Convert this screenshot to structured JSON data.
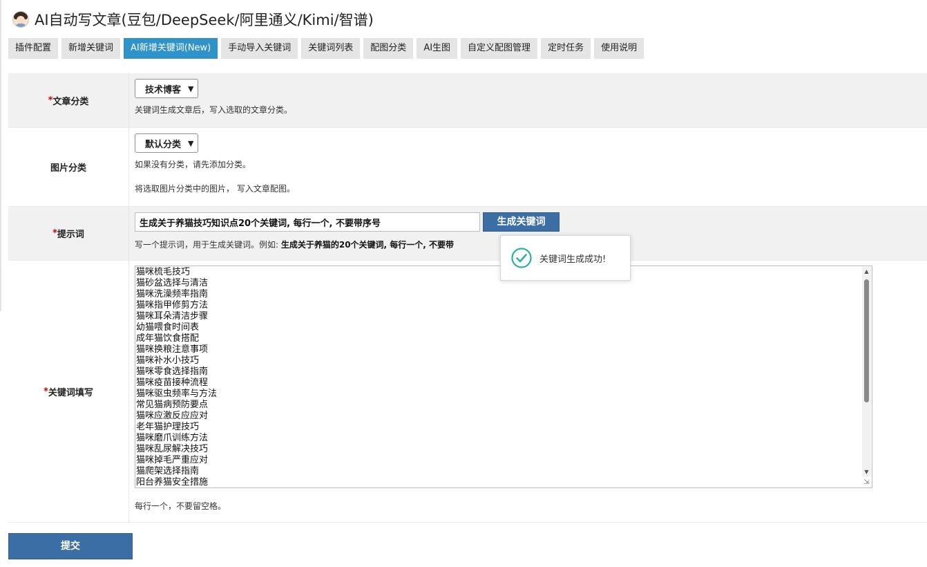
{
  "app": {
    "title": "AI自动写文章(豆包/DeepSeek/阿里通义/Kimi/智谱)"
  },
  "tabs": [
    {
      "label": "插件配置",
      "active": false
    },
    {
      "label": "新增关键词",
      "active": false
    },
    {
      "label": "AI新增关键词(New)",
      "active": true
    },
    {
      "label": "手动导入关键词",
      "active": false
    },
    {
      "label": "关键词列表",
      "active": false
    },
    {
      "label": "配图分类",
      "active": false
    },
    {
      "label": "AI生图",
      "active": false
    },
    {
      "label": "自定义配图管理",
      "active": false
    },
    {
      "label": "定时任务",
      "active": false
    },
    {
      "label": "使用说明",
      "active": false
    }
  ],
  "form": {
    "article_category": {
      "required": "*",
      "label": "文章分类",
      "selected": "技术博客",
      "help": "关键词生成文章后，写入选取的文章分类。"
    },
    "image_category": {
      "label": "图片分类",
      "selected": "默认分类",
      "help1": "如果没有分类，请先添加分类。",
      "help2": "将选取图片分类中的图片， 写入文章配图。"
    },
    "prompt": {
      "required": "*",
      "label": "提示词",
      "value": "生成关于养猫技巧知识点20个关键词, 每行一个, 不要带序号",
      "button": "生成关键词",
      "help_prefix": "写一个提示词，用于生成关键词。例如: ",
      "help_example": "生成关于养猫的20个关键词, 每行一个, 不要带"
    },
    "keywords": {
      "required": "*",
      "label": "关键词填写",
      "items": [
        "猫咪梳毛技巧",
        "猫砂盆选择与清洁",
        "猫咪洗澡频率指南",
        "猫咪指甲修剪方法",
        "猫咪耳朵清洁步骤",
        "幼猫喂食时间表",
        "成年猫饮食搭配",
        "猫咪换粮注意事项",
        "猫咪补水小技巧",
        "猫咪零食选择指南",
        "猫咪疫苗接种流程",
        "猫咪驱虫频率与方法",
        "常见猫病预防要点",
        "猫咪应激反应应对",
        "老年猫护理技巧",
        "猫咪磨爪训练方法",
        "猫咪乱尿解决技巧",
        "猫咪掉毛严重应对",
        "猫爬架选择指南",
        "阳台养猫安全措施"
      ],
      "help": "每行一个，不要留空格。"
    },
    "submit": "提交"
  },
  "toast": {
    "message": "关键词生成成功!",
    "icon": "check-circle-icon",
    "color": "#2bb39b"
  },
  "colors": {
    "primary": "#3a6ea5",
    "tab_active": "#2f93c9",
    "required": "#d10000"
  }
}
